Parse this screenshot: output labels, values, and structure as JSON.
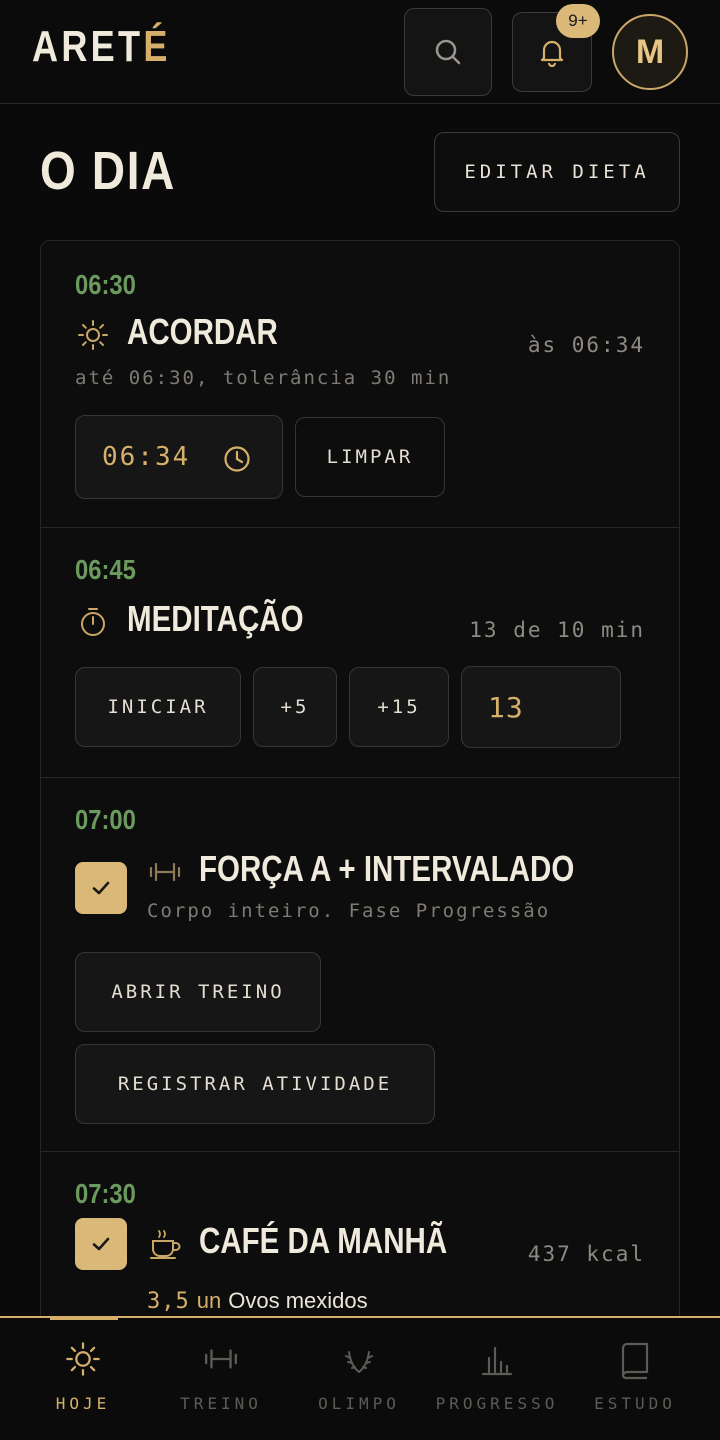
{
  "header": {
    "logo_main": "ARET",
    "logo_accent": "É",
    "notification_badge": "9+",
    "avatar_initial": "M"
  },
  "page": {
    "title": "O DIA",
    "edit_diet_label": "EDITAR DIETA"
  },
  "items": [
    {
      "time": "06:30",
      "icon": "sun-icon",
      "title": "ACORDAR",
      "right_note": "às 06:34",
      "subtitle": "até 06:30, tolerância 30 min",
      "time_input": "06:34",
      "clear_label": "LIMPAR"
    },
    {
      "time": "06:45",
      "icon": "timer-icon",
      "title": "MEDITAÇÃO",
      "right_note": "13 de 10 min",
      "start_label": "INICIAR",
      "plus5_label": "+5",
      "plus15_label": "+15",
      "minutes_value": "13"
    },
    {
      "time": "07:00",
      "icon": "dumbbell-icon",
      "checked": true,
      "title": "FORÇA A + INTERVALADO",
      "subtitle": "Corpo inteiro. Fase Progressão",
      "open_workout_label": "ABRIR TREINO",
      "register_activity_label": "REGISTRAR ATIVIDADE"
    },
    {
      "time": "07:30",
      "icon": "coffee-cup-icon",
      "checked": true,
      "title": "CAFÉ DA MANHÃ",
      "right_note": "437 kcal",
      "food_qty": "3,5",
      "food_unit": "un",
      "food_name": "Ovos mexidos"
    }
  ],
  "nav": [
    {
      "label": "HOJE",
      "icon": "sun-icon",
      "active": true
    },
    {
      "label": "TREINO",
      "icon": "dumbbell-icon",
      "active": false
    },
    {
      "label": "OLIMPO",
      "icon": "laurel-icon",
      "active": false
    },
    {
      "label": "PROGRESSO",
      "icon": "bar-chart-icon",
      "active": false
    },
    {
      "label": "ESTUDO",
      "icon": "book-icon",
      "active": false
    }
  ],
  "colors": {
    "accent": "#d6b06a",
    "time_green": "#6b9a5e",
    "background": "#0a0a0a"
  }
}
